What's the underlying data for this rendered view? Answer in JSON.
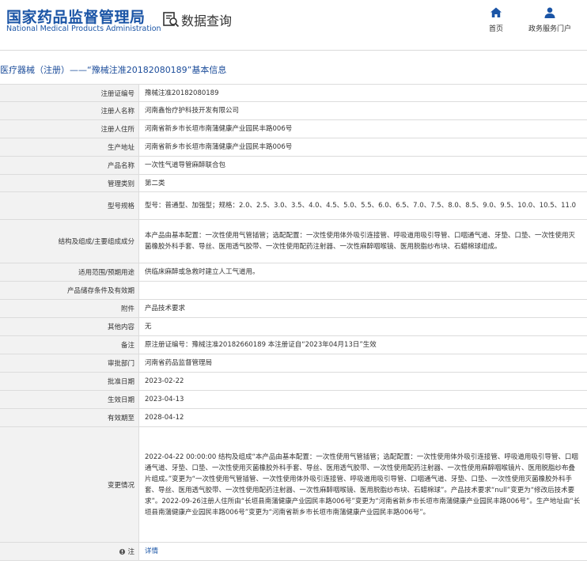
{
  "header": {
    "logo_cn": "国家药品监督管理局",
    "logo_en": "National Medical Products Administration",
    "data_query": "数据查询",
    "nav": {
      "home": "首页",
      "service": "政务服务门户"
    }
  },
  "page_title": "医疗器械（注册）——“豫械注准20182080189”基本信息",
  "rows": [
    {
      "label": "注册证编号",
      "value": "豫械注准20182080189"
    },
    {
      "label": "注册人名称",
      "value": "河南鑫怡疗护科技开发有限公司"
    },
    {
      "label": "注册人住所",
      "value": "河南省新乡市长垣市南蒲健康产业园民丰路006号"
    },
    {
      "label": "生产地址",
      "value": "河南省新乡市长垣市南蒲健康产业园民丰路006号"
    },
    {
      "label": "产品名称",
      "value": "一次性气道导管麻醉联合包"
    },
    {
      "label": "管理类别",
      "value": "第二类"
    },
    {
      "label": "型号规格",
      "value": "型号：普通型、加强型；规格：2.0、2.5、3.0、3.5、4.0、4.5、5.0、5.5、6.0、6.5、7.0、7.5、8.0、8.5、9.0、9.5、10.0、10.5、11.0"
    },
    {
      "label": "结构及组成/主要组成成分",
      "value": "本产品由基本配置：一次性使用气管插管；选配配置：一次性使用体外吸引连接管、呼吸道用吸引导管、口咽通气道、牙垫、口垫、一次性使用灭菌橡胶外科手套、导丝、医用透气胶带、一次性使用配药注射器、一次性麻醉咽喉镜、医用脱脂纱布块、石蜡棉球组成。"
    },
    {
      "label": "适用范围/预期用途",
      "value": "供临床麻醉或急救时建立人工气道用。"
    },
    {
      "label": "产品储存条件及有效期",
      "value": ""
    },
    {
      "label": "附件",
      "value": "产品技术要求"
    },
    {
      "label": "其他内容",
      "value": "无"
    },
    {
      "label": "备注",
      "value": "原注册证编号：豫械注准20182660189 本注册证自“2023年04月13日”生效"
    },
    {
      "label": "审批部门",
      "value": "河南省药品监督管理局"
    },
    {
      "label": "批准日期",
      "value": "2023-02-22"
    },
    {
      "label": "生效日期",
      "value": "2023-04-13"
    },
    {
      "label": "有效期至",
      "value": "2028-04-12"
    },
    {
      "label": "变更情况",
      "value": "2022-04-22 00:00:00 结构及组成“本产品由基本配置：一次性使用气管插管；选配配置：一次性使用体外吸引连接管、呼吸道用吸引导管、口咽通气道、牙垫、口垫、一次性使用灭菌橡胶外科手套、导丝、医用透气胶带、一次性使用配药注射器、一次性使用麻醉咽喉镜片、医用脱脂纱布叠片组成。”变更为“一次性使用气管插管、一次性使用体外吸引连接管、呼吸道用吸引导管、口咽通气道、牙垫、口垫、一次性使用灭菌橡胶外科手套、导丝、医用透气胶带、一次性使用配药注射器、一次性麻醉咽喉镜、医用脱脂纱布块、石蜡棉球”。产品技术要求“null”变更为“修改后技术要求”。2022-09-26注册人住所由“长垣县南蒲健康产业园民丰路006号”变更为“河南省新乡市长垣市南蒲健康产业园民丰路006号”。生产地址由“长垣县南蒲健康产业园民丰路006号”变更为“河南省新乡市长垣市南蒲健康产业园民丰路006号”。"
    },
    {
      "label": "注",
      "value": "详情",
      "label_icon": "note-icon"
    }
  ],
  "colors": {
    "brand": "#1b55a6",
    "label_bg": "#f2f2f2",
    "border": "#dcdcdc",
    "title": "#1b4c9a"
  }
}
